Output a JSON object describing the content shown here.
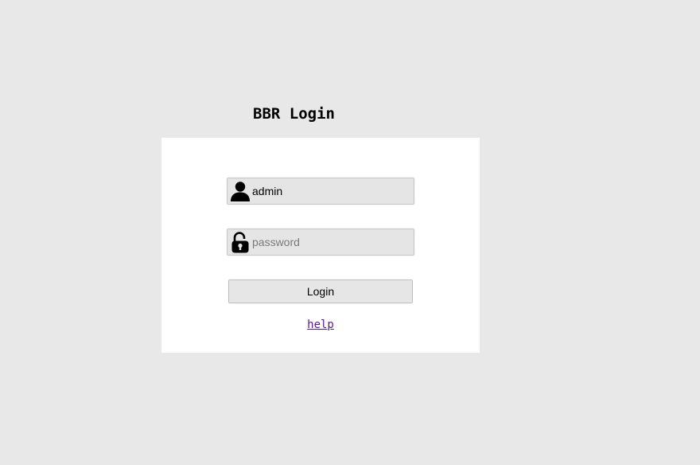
{
  "login": {
    "title": "BBR Login",
    "username": {
      "value": "admin",
      "placeholder": "",
      "icon": "user-icon"
    },
    "password": {
      "value": "",
      "placeholder": "password",
      "icon": "lock-icon"
    },
    "submit_label": "Login",
    "help_label": "help"
  }
}
